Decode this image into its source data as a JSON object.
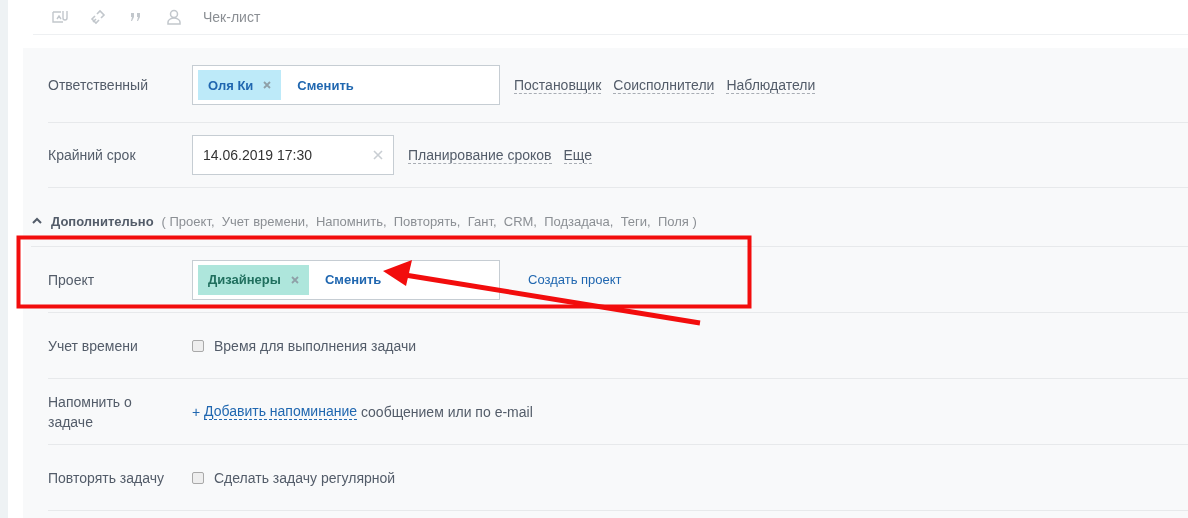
{
  "toolbar": {
    "checklist": "Чек-лист"
  },
  "main_rows": [
    {
      "kind": "selector",
      "label": "Ответственный",
      "tag": "Оля Ки",
      "color": "#bdeaf9",
      "change": "Сменить",
      "links": [
        "Постановщик",
        "Соисполнители",
        "Наблюдатели"
      ]
    },
    {
      "kind": "date",
      "label": "Крайний срок",
      "value": "14.06.2019 17:30",
      "links": [
        "Планирование сроков",
        "Еще"
      ]
    }
  ],
  "additional": {
    "title": "Дополнительно",
    "expanded": true,
    "options": "( Проект,  Учет времени,  Напомнить,  Повторять,  Гант,  CRM,  Подзадача,  Теги,  Поля )"
  },
  "extra_rows": [
    {
      "kind": "selector",
      "label": "Проект",
      "tag": "Дизайнеры",
      "color": "#aee6dc",
      "change": "Сменить",
      "action": "Создать проект",
      "highlighted": true
    },
    {
      "kind": "checkbox",
      "label": "Учет времени",
      "text": "Время для выполнения задачи",
      "checked": false
    },
    {
      "kind": "reminder",
      "label": "Напомнить о задаче",
      "plus": "+",
      "link": "Добавить напоминание",
      "text": "сообщением или по e-mail"
    },
    {
      "kind": "checkbox",
      "label": "Повторять задачу",
      "text": "Сделать задачу регулярной",
      "checked": false
    }
  ]
}
